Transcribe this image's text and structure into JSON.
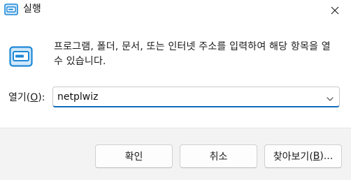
{
  "window": {
    "title": "실행",
    "close_symbol": "×"
  },
  "content": {
    "description": "프로그램, 폴더, 문서, 또는 인터넷 주소를 입력하여 해당 항목을 열 수 있습니다.",
    "open_label_prefix": "열기(",
    "open_label_key": "O",
    "open_label_suffix": "):",
    "open_value": "netplwiz"
  },
  "buttons": {
    "ok_label": "확인",
    "cancel_label": "취소",
    "browse_prefix": "찾아보기(",
    "browse_key": "B",
    "browse_suffix": ")..."
  },
  "colors": {
    "accent": "#0f6cbd",
    "footer_bg": "#f3f3f3",
    "run_icon_blue": "#1e88d6",
    "run_icon_light": "#cfe8fa"
  },
  "icons": {
    "app": "run-icon",
    "body": "run-icon",
    "close": "close-icon",
    "dropdown": "chevron-down-icon"
  }
}
